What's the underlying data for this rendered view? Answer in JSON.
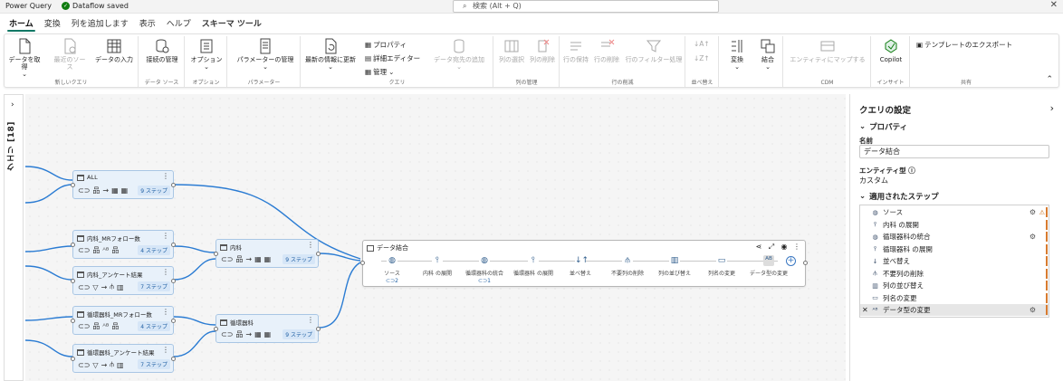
{
  "titlebar": {
    "app": "Power Query",
    "saved": "Dataflow saved",
    "search_placeholder": "検索 (Alt + Q)"
  },
  "menu_tabs": [
    "ホーム",
    "変換",
    "列を追加します",
    "表示",
    "ヘルプ",
    "スキーマ ツール"
  ],
  "ribbon": {
    "new_query": {
      "get_data": "データを取得",
      "recent": "最近のソース",
      "enter_data": "データの入力",
      "label": "新しいクエリ"
    },
    "data_source": {
      "manage": "接続の管理",
      "label": "データ ソース"
    },
    "options": {
      "options": "オプション",
      "label": "オプション"
    },
    "params": {
      "manage": "パラメーターの管理",
      "label": "パラメーター"
    },
    "query": {
      "refresh": "最新の情報に更新",
      "properties": "プロパティ",
      "advanced": "詳細エディター",
      "manage": "管理",
      "add_dest": "データ宛先の追加",
      "label": "クエリ"
    },
    "cols": {
      "choose": "列の選択",
      "remove": "列の削除",
      "label": "列の管理"
    },
    "rows": {
      "keep": "行の保持",
      "remove": "行の削除",
      "filter": "行のフィルター処理",
      "label": "行の削減"
    },
    "sort": {
      "label": "並べ替え"
    },
    "transform": {
      "transform": "変換",
      "combine": "結合"
    },
    "cdm": {
      "map": "エンティティにマップする",
      "label": "CDM"
    },
    "insight": {
      "copilot": "Copilot",
      "label": "インサイト"
    },
    "share": {
      "export": "テンプレートのエクスポート",
      "label": "共有"
    }
  },
  "left_pane": {
    "label": "クエリ [18]"
  },
  "nodes": {
    "all": {
      "title": "ALL",
      "steps": "9 ステップ"
    },
    "naika_mr": {
      "title": "内科_MRフォロー数",
      "steps": "4 ステップ"
    },
    "naika_ank": {
      "title": "内科_アンケート結果",
      "steps": "7 ステップ"
    },
    "naika": {
      "title": "内科",
      "steps": "9 ステップ"
    },
    "junkan_mr": {
      "title": "循環器科_MRフォロー数",
      "steps": "4 ステップ"
    },
    "junkan_ank": {
      "title": "循環器科_アンケート結果",
      "steps": "7 ステップ"
    },
    "junkan": {
      "title": "循環器科",
      "steps": "9 ステップ"
    }
  },
  "merge_node": {
    "title": "データ結合",
    "steps": [
      {
        "label": "ソース",
        "sub": "2"
      },
      {
        "label": "内科 の展開",
        "sub": ""
      },
      {
        "label": "循環器科の統合",
        "sub": "1"
      },
      {
        "label": "循環器科 の展開",
        "sub": ""
      },
      {
        "label": "並べ替え",
        "sub": ""
      },
      {
        "label": "不要列の削除",
        "sub": ""
      },
      {
        "label": "列の並び替え",
        "sub": ""
      },
      {
        "label": "列名の変更",
        "sub": ""
      },
      {
        "label": "データ型の変更",
        "sub": ""
      }
    ]
  },
  "settings": {
    "title": "クエリの設定",
    "properties": "プロパティ",
    "name_label": "名前",
    "name_value": "データ結合",
    "entity_label": "エンティティ型",
    "entity_value": "カスタム",
    "applied_steps": "適用されたステップ",
    "steps": [
      "ソース",
      "内科 の展開",
      "循環器科の統合",
      "循環器科 の展開",
      "並べ替え",
      "不要列の削除",
      "列の並び替え",
      "列名の変更",
      "データ型の変更"
    ]
  },
  "colors": {
    "accent": "#117865",
    "node_fill": "#e8f1fa",
    "edge": "#2b7cd3",
    "warn": "#d87b2f"
  }
}
